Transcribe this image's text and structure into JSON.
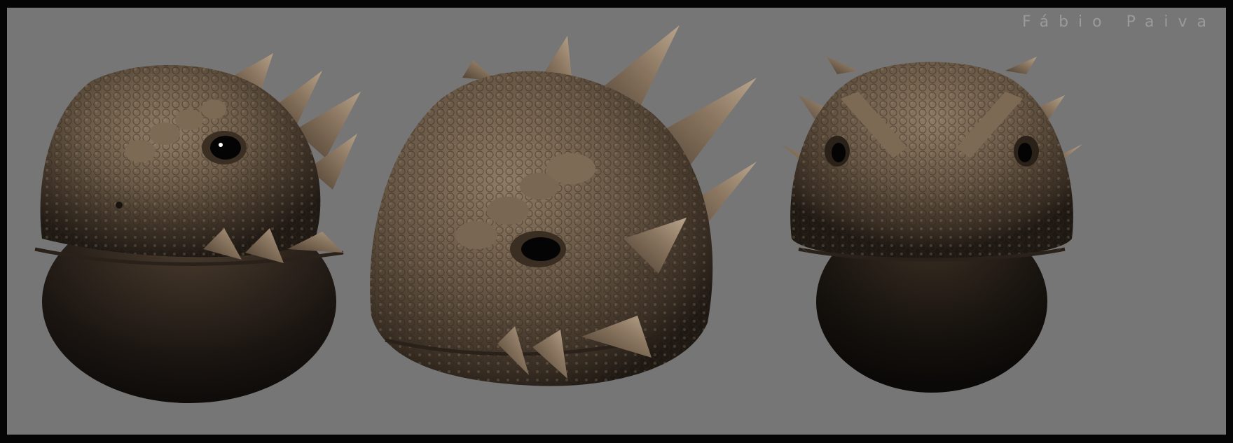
{
  "signature": "Fábio Paiva",
  "background_color": "#767676",
  "border_color": "#050505",
  "model_color": "#6e5d4a",
  "views": [
    {
      "name": "three-quarter-left-view"
    },
    {
      "name": "three-quarter-front-view"
    },
    {
      "name": "front-view"
    }
  ]
}
